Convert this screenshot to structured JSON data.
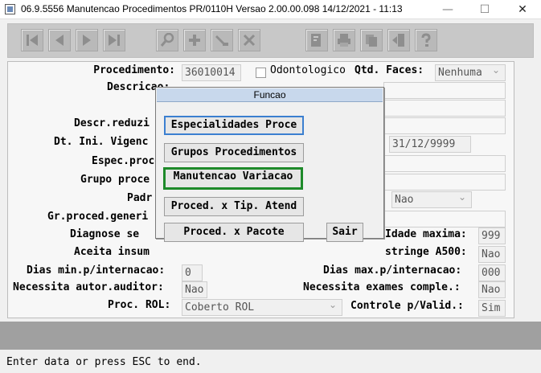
{
  "window": {
    "title": "06.9.5556 Manutencao  Procedimentos PR/0110H Versao 2.00.00.098 14/12/2021 - 11:13",
    "minimize": "—",
    "maximize": "☐",
    "close": "✕"
  },
  "toolbar": {
    "icons": [
      "first-record-icon",
      "previous-record-icon",
      "next-record-icon",
      "last-record-icon",
      "search-icon",
      "add-icon",
      "edit-icon",
      "delete-icon",
      "filter-icon",
      "print-icon",
      "copy-icon",
      "exit-icon",
      "help-icon"
    ]
  },
  "form": {
    "procedimento_label": "Procedimento:",
    "procedimento_value": "36010014",
    "odontologico_label": "Odontologico",
    "qtd_faces_label": "Qtd. Faces:",
    "qtd_faces_value": "Nenhuma",
    "descricao_label": "Descricao:",
    "descr_reduzida_label": "Descr.reduzi",
    "dt_ini_label": "Dt. Ini. Vigenc",
    "dt_fim_value": "31/12/9999",
    "espec_label": "Espec.proce",
    "grupo_label": "Grupo proce",
    "padr_label": "Padr",
    "padr_value": "Nao",
    "gr_proced_label": "Gr.proced.generi",
    "diagnose_label": "Diagnose se",
    "idade_maxima_label": "Idade maxima:",
    "idade_maxima_value": "999",
    "aceita_insum_label": "Aceita insum",
    "restringe_label": "stringe A500:",
    "restringe_value": "Nao",
    "dias_min_label": "Dias min.p/internacao:",
    "dias_min_value": "0",
    "dias_max_label": "Dias max.p/internacao:",
    "dias_max_value": "000",
    "necessita_autor_label": "Necessita autor.auditor:",
    "necessita_autor_value": "Nao",
    "necessita_exames_label": "Necessita exames comple.:",
    "necessita_exames_value": "Nao",
    "proc_rol_label": "Proc. ROL:",
    "proc_rol_value": "Coberto ROL",
    "controle_label": "Controle p/Valid.:",
    "controle_value": "Sim"
  },
  "dialog": {
    "title": "Funcao",
    "buttons": {
      "especialidades": "Especialidades Proce",
      "grupos": "Grupos Procedimentos",
      "manutencao_variacao": "Manutencao Variacao",
      "tip_atend": "Proced. x Tip. Atend",
      "pacote": "Proced. x Pacote",
      "sair": "Sair"
    }
  },
  "status": {
    "message": "Enter data or press ESC to end."
  }
}
